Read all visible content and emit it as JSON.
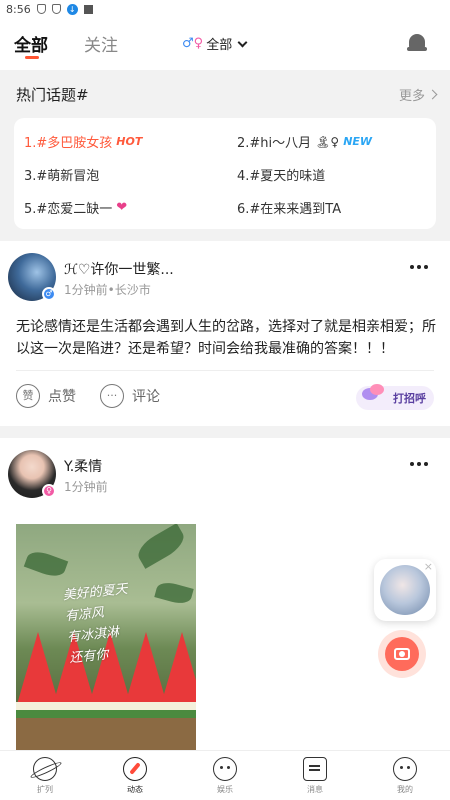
{
  "status_bar": {
    "time": "8:56"
  },
  "header": {
    "tabs": [
      {
        "label": "全部",
        "active": true
      },
      {
        "label": "关注",
        "active": false
      }
    ],
    "gender_filter": {
      "symbol_male": "♂",
      "symbol_female": "♀",
      "label": "全部"
    }
  },
  "hot_topics": {
    "title": "热门话题#",
    "more": "更多",
    "items": [
      {
        "text": "1.#多巴胺女孩",
        "tag": "HOT"
      },
      {
        "text": "2.#hi～八月",
        "emoji": "🏝♀",
        "tag": "NEW"
      },
      {
        "text": "3.#萌新冒泡"
      },
      {
        "text": "4.#夏天的味道"
      },
      {
        "text": "5.#恋爱二缺一",
        "emoji": "❤"
      },
      {
        "text": "6.#在来来遇到TA"
      }
    ]
  },
  "posts": [
    {
      "username": "ℋ♡许你一世繁...",
      "meta": "1分钟前•长沙市",
      "gender_badge": "♂",
      "text": "无论感情还是生活都会遇到人生的岔路，选择对了就是相亲相爱；所以这一次是陷进？还是希望？时间会给我最准确的答案！！！",
      "like_icon": "赞",
      "like_label": "点赞",
      "comment_label": "评论",
      "greet_label": "打招呼"
    },
    {
      "username": "Y.柔情",
      "meta": "1分钟前",
      "gender_badge": "♀",
      "photo_text": [
        "美好的夏天",
        "有凉风",
        "有冰淇淋",
        "还有你"
      ]
    }
  ],
  "floating": {
    "close": "×"
  },
  "bottom_nav": [
    {
      "label": "扩列",
      "icon": "planet-icon"
    },
    {
      "label": "动态",
      "icon": "compass-icon",
      "active": true
    },
    {
      "label": "娱乐",
      "icon": "face-icon"
    },
    {
      "label": "消息",
      "icon": "message-icon"
    },
    {
      "label": "我的",
      "icon": "smile-icon"
    }
  ]
}
